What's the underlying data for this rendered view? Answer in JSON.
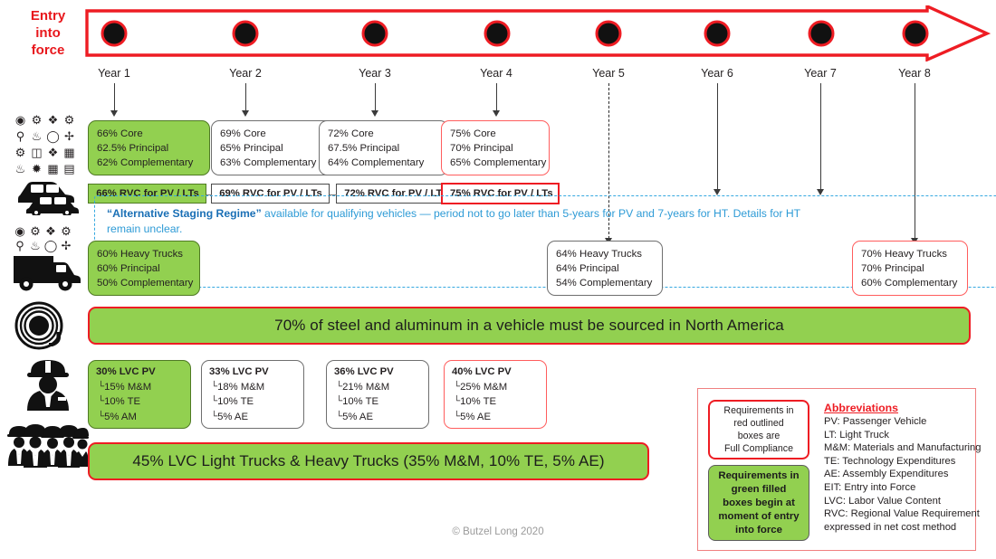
{
  "entry_label": "Entry\ninto\nforce",
  "entry_label_lines": [
    "Entry",
    "into",
    "force"
  ],
  "timeline": {
    "dots": 8,
    "arrow_color": "#ee1c23",
    "dot_color": "#111111",
    "years": [
      {
        "label": "Year 1",
        "line": "solid"
      },
      {
        "label": "Year 2",
        "line": "solid"
      },
      {
        "label": "Year 3",
        "line": "solid"
      },
      {
        "label": "Year 4",
        "line": "solid"
      },
      {
        "label": "Year 5",
        "line": "dashed"
      },
      {
        "label": "Year 6",
        "line": "solid"
      },
      {
        "label": "Year 7",
        "line": "solid"
      },
      {
        "label": "Year 8",
        "line": "solid"
      }
    ]
  },
  "rows": {
    "parts": {
      "icon_name": "auto-parts-grid-icon",
      "boxes": [
        {
          "style": "green",
          "lines": [
            "66% Core",
            "62.5% Principal",
            "62% Complementary"
          ]
        },
        {
          "style": "outline",
          "lines": [
            "69% Core",
            "65% Principal",
            "63% Complementary"
          ]
        },
        {
          "style": "outline",
          "lines": [
            "72% Core",
            "67.5% Principal",
            "64% Complementary"
          ]
        },
        {
          "style": "red",
          "lines": [
            "75% Core",
            "70% Principal",
            "65% Complementary"
          ]
        }
      ]
    },
    "rvc": {
      "icon_name": "cars-icon",
      "boxes": [
        {
          "style": "green",
          "label": "66% RVC for PV / LTs"
        },
        {
          "style": "outline",
          "label": "69% RVC for PV / LTs"
        },
        {
          "style": "outline",
          "label": "72% RVC for PV / LTs"
        },
        {
          "style": "red",
          "label": "75% RVC for PV / LTs"
        }
      ]
    },
    "alt_staging": {
      "quoted": "“Alternative Staging Regime”",
      "rest": " available for qualifying vehicles — period not to go later than 5-years for PV and 7-years for HT. Details for HT",
      "line2": "remain unclear."
    },
    "heavy_trucks": {
      "icon_name": "heavy-truck-icon",
      "boxes": [
        {
          "style": "green",
          "lines": [
            "60% Heavy Trucks",
            "60% Principal",
            "50% Complementary"
          ]
        },
        {
          "style": "outline",
          "lines": [
            "64% Heavy Trucks",
            "64% Principal",
            "54% Complementary"
          ]
        },
        {
          "style": "red",
          "lines": [
            "70% Heavy Trucks",
            "70% Principal",
            "60% Complementary"
          ]
        }
      ]
    },
    "steel": {
      "icon_name": "steel-coil-icon",
      "banner": "70% of steel and aluminum in a vehicle must be sourced in North America"
    },
    "lvc_pv": {
      "icon_name": "worker-icon",
      "boxes": [
        {
          "style": "green",
          "header": "30% LVC PV",
          "subs": [
            "15% M&M",
            "10% TE",
            "5% AM"
          ]
        },
        {
          "style": "outline",
          "header": "33% LVC PV",
          "subs": [
            "18% M&M",
            "10% TE",
            "5% AE"
          ]
        },
        {
          "style": "outline",
          "header": "36% LVC PV",
          "subs": [
            "21% M&M",
            "10% TE",
            "5% AE"
          ]
        },
        {
          "style": "red",
          "header": "40% LVC PV",
          "subs": [
            "25% M&M",
            "10% TE",
            "5% AE"
          ]
        }
      ]
    },
    "lvc_trucks": {
      "icon_name": "workers-group-icon",
      "banner": "45% LVC Light Trucks & Heavy Trucks (35% M&M, 10% TE, 5% AE)"
    }
  },
  "legend": {
    "red_chip_lines": [
      "Requirements in",
      "red outlined",
      "boxes are",
      "Full Compliance"
    ],
    "green_chip_lines": [
      "Requirements in",
      "green filled",
      "boxes begin at",
      "moment of entry",
      "into force"
    ],
    "abbrev_title": "Abbreviations",
    "abbrev_items": [
      "PV: Passenger Vehicle",
      "LT: Light Truck",
      "M&M: Materials and Manufacturing",
      "TE: Technology Expenditures",
      "AE: Assembly Expenditures",
      "EIT: Entry into Force",
      "LVC: Labor Value Content",
      "RVC: Regional Value Requirement",
      "expressed in net cost method"
    ]
  },
  "footer": "© Butzel Long 2020",
  "colors": {
    "accent_red": "#ee1c23",
    "green_fill": "#92d050",
    "blue_dashed": "#35a8e0",
    "blue_text": "#2e9bd6"
  }
}
